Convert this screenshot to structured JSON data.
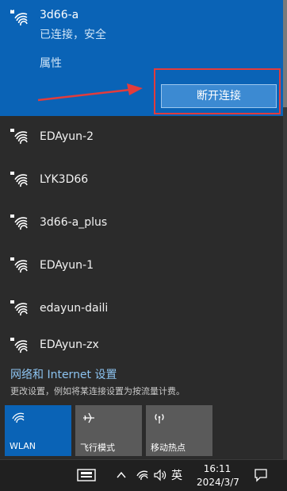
{
  "connected_network": {
    "name": "3d66-a",
    "status": "已连接，安全",
    "properties_label": "属性",
    "disconnect_label": "断开连接"
  },
  "networks": [
    {
      "name": "EDAyun-2"
    },
    {
      "name": "LYK3D66"
    },
    {
      "name": "3d66-a_plus"
    },
    {
      "name": "EDAyun-1"
    },
    {
      "name": "edayun-daili"
    },
    {
      "name": "EDAyun-zx"
    }
  ],
  "settings": {
    "title": "网络和 Internet 设置",
    "description": "更改设置，例如将某连接设置为按流量计费。"
  },
  "quick_actions": [
    {
      "label": "WLAN",
      "icon": "wifi-icon",
      "active": true
    },
    {
      "label": "飞行模式",
      "icon": "airplane-icon",
      "active": false
    },
    {
      "label": "移动热点",
      "icon": "hotspot-icon",
      "active": false
    }
  ],
  "taskbar": {
    "ime_label": "英",
    "time": "16:11",
    "date": "2024/3/7"
  },
  "colors": {
    "accent": "#0a63b6",
    "annotation": "#e23c3c"
  }
}
